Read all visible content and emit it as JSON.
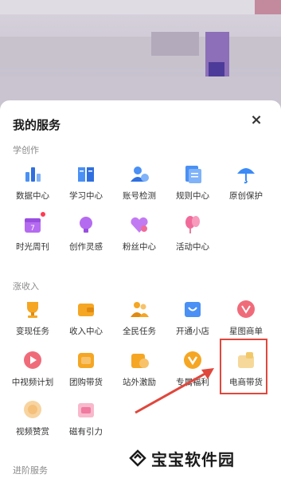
{
  "panel": {
    "title": "我的服务",
    "close_icon": "×"
  },
  "sections": [
    {
      "label": "学创作",
      "items": [
        {
          "label": "数据中心",
          "icon": "bar-chart-icon",
          "color": "#3a8af7"
        },
        {
          "label": "学习中心",
          "icon": "book-icon",
          "color": "#3a8af7"
        },
        {
          "label": "账号检测",
          "icon": "user-check-icon",
          "color": "#3a8af7"
        },
        {
          "label": "规则中心",
          "icon": "document-icon",
          "color": "#3a8af7"
        },
        {
          "label": "原创保护",
          "icon": "umbrella-icon",
          "color": "#3a8af7"
        },
        {
          "label": "时光周刊",
          "icon": "calendar-icon",
          "color": "#b56bf0"
        },
        {
          "label": "创作灵感",
          "icon": "lightbulb-icon",
          "color": "#b56bf0"
        },
        {
          "label": "粉丝中心",
          "icon": "heart-icon",
          "color": "#b56bf0"
        },
        {
          "label": "活动中心",
          "icon": "balloon-icon",
          "color": "#f06b9a"
        }
      ]
    },
    {
      "label": "涨收入",
      "items": [
        {
          "label": "变现任务",
          "icon": "trophy-icon",
          "color": "#f5a623"
        },
        {
          "label": "收入中心",
          "icon": "wallet-icon",
          "color": "#f5a623"
        },
        {
          "label": "全民任务",
          "icon": "people-icon",
          "color": "#f5a623"
        },
        {
          "label": "开通小店",
          "icon": "shop-icon",
          "color": "#3a8af7"
        },
        {
          "label": "星图商单",
          "icon": "star-map-icon",
          "color": "#f06b7a"
        },
        {
          "label": "中视频计划",
          "icon": "play-icon",
          "color": "#f06b7a"
        },
        {
          "label": "团购带货",
          "icon": "group-buy-icon",
          "color": "#f5a623"
        },
        {
          "label": "站外激励",
          "icon": "incentive-icon",
          "color": "#f5a623"
        },
        {
          "label": "专属福利",
          "icon": "welfare-icon",
          "color": "#f5a623"
        },
        {
          "label": "电商带货",
          "icon": "ecommerce-icon",
          "color": "#f2c96a"
        },
        {
          "label": "视频赞赏",
          "icon": "reward-icon",
          "color": "#f5c07a"
        },
        {
          "label": "磁有引力",
          "icon": "magnet-icon",
          "color": "#f07aa0"
        }
      ]
    },
    {
      "label": "进阶服务"
    }
  ],
  "watermark": {
    "text": "宝宝软件园"
  }
}
